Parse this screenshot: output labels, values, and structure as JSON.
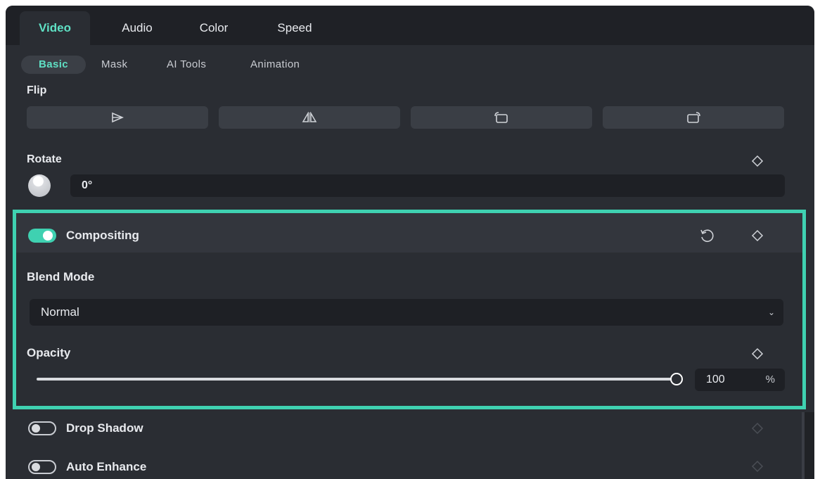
{
  "tabs": {
    "top": [
      "Video",
      "Audio",
      "Color",
      "Speed"
    ],
    "active_top": "Video",
    "sub": [
      "Basic",
      "Mask",
      "AI Tools",
      "Animation"
    ],
    "active_sub": "Basic"
  },
  "flip": {
    "label": "Flip",
    "buttons": [
      "flip-horizontal-icon",
      "flip-vertical-icon",
      "rotate-left-icon",
      "rotate-right-icon"
    ]
  },
  "rotate": {
    "label": "Rotate",
    "value": "0°"
  },
  "compositing": {
    "label": "Compositing",
    "enabled": true,
    "blend_mode": {
      "label": "Blend Mode",
      "value": "Normal"
    },
    "opacity": {
      "label": "Opacity",
      "value": "100",
      "unit": "%",
      "level": 100
    }
  },
  "drop_shadow": {
    "label": "Drop Shadow",
    "enabled": false
  },
  "auto_enhance": {
    "label": "Auto Enhance",
    "enabled": false
  },
  "colors": {
    "accent": "#3fd1b1",
    "panel_bg": "#2a2d33",
    "field_bg": "#1e2025",
    "highlight_border": "#3fd1b1"
  }
}
